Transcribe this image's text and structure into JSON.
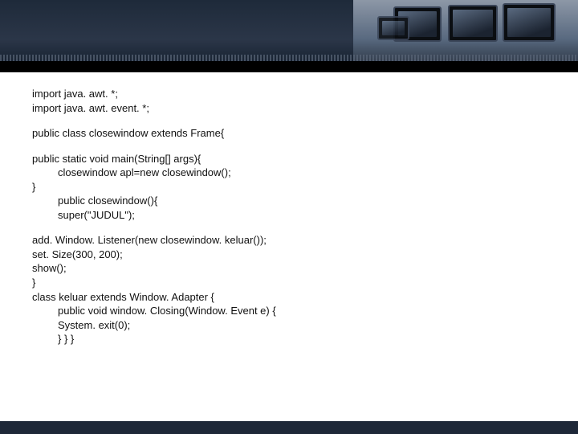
{
  "code": {
    "import1": "import java. awt. *;",
    "import2": "import java. awt. event. *;",
    "classdecl": "public class closewindow extends Frame{",
    "mainsig": "public static void main(String[] args){",
    "mainbody": "closewindow apl=new closewindow();",
    "close1": "}",
    "ctor1": "public closewindow(){",
    "ctor2": "super(\"JUDUL\");",
    "addlistener": "add. Window. Listener(new closewindow. keluar());",
    "setsize": " set. Size(300, 200);",
    "show": "show();",
    "close2": "}",
    "classkeluar": "class keluar extends Window. Adapter {",
    "winclosing": "public void window. Closing(Window. Event e) {",
    "sysexit": " System. exit(0);",
    "closes": "}       }   }"
  }
}
